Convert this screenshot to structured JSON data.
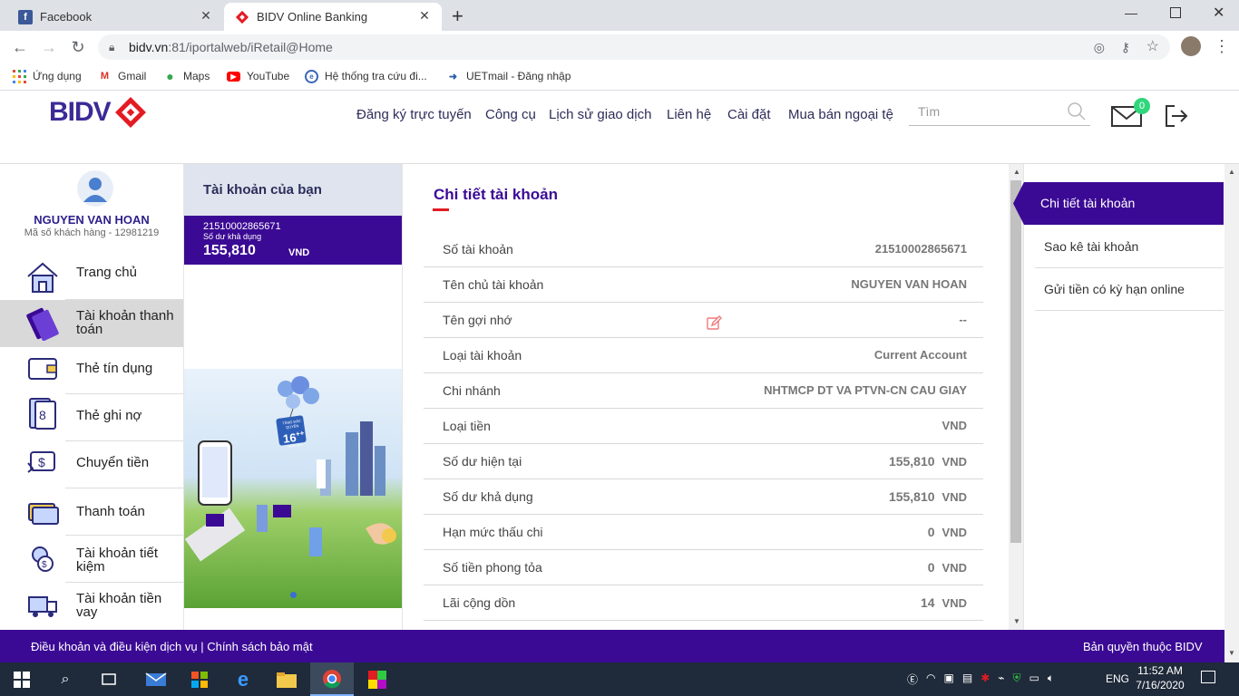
{
  "browser": {
    "tabs": [
      {
        "title": "Facebook",
        "icon": "facebook-icon"
      },
      {
        "title": "BIDV Online Banking",
        "icon": "bidv-icon"
      }
    ],
    "url_host": "bidv.vn",
    "url_path": ":81/iportalweb/iRetail@Home",
    "bookmarks": [
      {
        "label": "Ứng dụng"
      },
      {
        "label": "Gmail"
      },
      {
        "label": "Maps"
      },
      {
        "label": "YouTube"
      },
      {
        "label": "Hệ thống tra cứu đi..."
      },
      {
        "label": "UETmail - Đăng nhập"
      }
    ]
  },
  "header": {
    "logo_text": "BIDV",
    "nav": [
      "Đăng ký trực tuyến",
      "Công cụ",
      "Lịch sử giao dịch",
      "Liên hệ",
      "Cài đặt",
      "Mua bán ngoại tệ"
    ],
    "search_placeholder": "Tìm",
    "mail_count": "0"
  },
  "user": {
    "name": "NGUYEN VAN HOAN",
    "customer_id": "Mã số khách hàng - 12981219"
  },
  "sidebar": {
    "items": [
      {
        "label": "Trang chủ"
      },
      {
        "label": "Tài khoản thanh toán"
      },
      {
        "label": "Thẻ tín dụng"
      },
      {
        "label": "Thẻ ghi nợ"
      },
      {
        "label": "Chuyển tiền"
      },
      {
        "label": "Thanh toán"
      },
      {
        "label": "Tài khoản tiết kiệm"
      },
      {
        "label": "Tài khoản tiền vay"
      }
    ]
  },
  "accounts": {
    "heading": "Tài khoản của bạn",
    "number": "21510002865671",
    "balance_label": "Số dư khả dụng",
    "balance": "155,810",
    "currency": "VND",
    "banner_badge_top": "TĂNG ĐẶC QUYỀN",
    "banner_badge_num": "16",
    "banner_badge_suffix": "++",
    "banner_badge_bottom": "TIỆN ÍCH"
  },
  "detail": {
    "title": "Chi tiết tài khoản",
    "rows": [
      {
        "label": "Số tài khoản",
        "value": "21510002865671",
        "unit": ""
      },
      {
        "label": "Tên chủ tài khoản",
        "value": "NGUYEN VAN HOAN",
        "unit": ""
      },
      {
        "label": "Tên gợi nhớ",
        "value": "--",
        "unit": ""
      },
      {
        "label": "Loại tài khoản",
        "value": "Current Account",
        "unit": ""
      },
      {
        "label": "Chi nhánh",
        "value": "NHTMCP DT VA PTVN-CN CAU GIAY",
        "unit": ""
      },
      {
        "label": "Loại tiền",
        "value": "VND",
        "unit": ""
      },
      {
        "label": "Số dư hiện tại",
        "value": "155,810",
        "unit": "VND"
      },
      {
        "label": "Số dư khả dụng",
        "value": "155,810",
        "unit": "VND"
      },
      {
        "label": "Hạn mức thấu chi",
        "value": "0",
        "unit": "VND"
      },
      {
        "label": "Số tiền phong tỏa",
        "value": "0",
        "unit": "VND"
      },
      {
        "label": "Lãi cộng dồn",
        "value": "14",
        "unit": "VND"
      }
    ]
  },
  "right_menu": {
    "items": [
      {
        "label": "Chi tiết tài khoản",
        "active": true
      },
      {
        "label": "Sao kê tài khoản",
        "active": false
      },
      {
        "label": "Gửi tiền có kỳ hạn online",
        "active": false
      }
    ]
  },
  "footer": {
    "terms": "Điều khoản và điều kiện dịch vụ",
    "separator": "|",
    "privacy": "Chính sách bảo mật",
    "copyright": "Bản quyền thuộc BIDV"
  },
  "taskbar": {
    "lang": "ENG",
    "time": "11:52 AM",
    "date": "7/16/2020"
  },
  "colors": {
    "brand_purple": "#3b0a94",
    "accent_red": "#e31b23",
    "tab_gray": "#dee1e6"
  }
}
